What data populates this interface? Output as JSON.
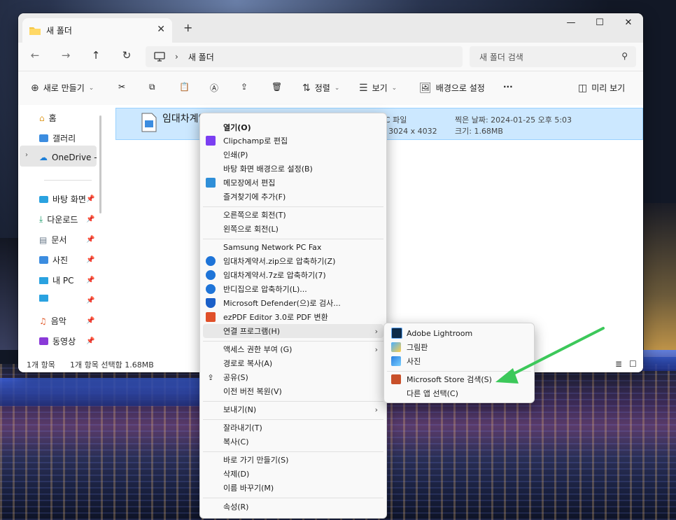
{
  "window": {
    "tab_title": "새 폴더",
    "tab_close": "✕",
    "new_tab": "+",
    "minimize": "—",
    "maximize": "☐",
    "close": "✕"
  },
  "nav": {
    "back": "←",
    "forward": "→",
    "up": "↑",
    "refresh": "↻",
    "breadcrumb_sep": "›",
    "breadcrumb_folder": "새 폴더",
    "search_placeholder": "새 폴더 검색"
  },
  "toolbar": {
    "new_label": "새로 만들기",
    "sort_label": "정렬",
    "view_label": "보기",
    "set_background_label": "배경으로 설정",
    "more_label": "···",
    "preview_label": "미리 보기"
  },
  "sidebar": {
    "items": [
      {
        "label": "홈",
        "icon": "home-icon"
      },
      {
        "label": "갤러리",
        "icon": "gallery-icon"
      },
      {
        "label": "OneDrive -",
        "icon": "cloud-icon"
      },
      {
        "label": "바탕 화면",
        "icon": "desktop-icon"
      },
      {
        "label": "다운로드",
        "icon": "download-icon"
      },
      {
        "label": "문서",
        "icon": "document-icon"
      },
      {
        "label": "사진",
        "icon": "pictures-icon"
      },
      {
        "label": "내 PC",
        "icon": "pc-icon"
      },
      {
        "label": "",
        "icon": "drive-icon"
      },
      {
        "label": "음악",
        "icon": "music-icon"
      },
      {
        "label": "동영상",
        "icon": "video-icon"
      }
    ]
  },
  "file": {
    "name": "임대차계약서",
    "type": "유형: HEIC 파일",
    "dimensions": "사진 크기: 3024 x 4032",
    "date_taken": "찍은 날짜: 2024-01-25 오후 5:03",
    "size": "크기: 1.68MB"
  },
  "status": {
    "count": "1개 항목",
    "selected": "1개 항목 선택함 1.68MB"
  },
  "context_menu": {
    "items": [
      {
        "label": "열기(O)",
        "bold": true
      },
      {
        "label": "Clipchamp로 편집",
        "icon": "clipchamp-icon"
      },
      {
        "label": "인쇄(P)"
      },
      {
        "label": "바탕 화면 배경으로 설정(B)"
      },
      {
        "label": "메모장에서 편집",
        "icon": "notepad-icon"
      },
      {
        "label": "즐겨찾기에 추가(F)"
      },
      {
        "label": "오른쪽으로 회전(T)"
      },
      {
        "label": "왼쪽으로 회전(L)"
      },
      {
        "label": "Samsung Network PC Fax"
      },
      {
        "label": "임대차계약서.zip으로 압축하기(Z)",
        "icon": "bandizip-icon"
      },
      {
        "label": "임대차계약서.7z로 압축하기(7)",
        "icon": "bandizip-icon"
      },
      {
        "label": "반디집으로 압축하기(L)...",
        "icon": "bandizip-icon"
      },
      {
        "label": "Microsoft Defender(으)로 검사...",
        "icon": "defender-icon"
      },
      {
        "label": "ezPDF Editor 3.0로 PDF 변환",
        "icon": "ezpdf-icon"
      },
      {
        "label": "연결 프로그램(H)",
        "arrow": "›"
      },
      {
        "label": "액세스 권한 부여 (G)",
        "arrow": "›"
      },
      {
        "label": "경로로 복사(A)"
      },
      {
        "label": "공유(S)",
        "icon": "share-icon"
      },
      {
        "label": "이전 버전 복원(V)"
      },
      {
        "label": "보내기(N)",
        "arrow": "›"
      },
      {
        "label": "잘라내기(T)"
      },
      {
        "label": "복사(C)"
      },
      {
        "label": "바로 가기 만들기(S)"
      },
      {
        "label": "삭제(D)"
      },
      {
        "label": "이름 바꾸기(M)"
      },
      {
        "label": "속성(R)"
      }
    ]
  },
  "submenu": {
    "items": [
      {
        "label": "Adobe Lightroom",
        "icon": "lightroom-icon"
      },
      {
        "label": "그림판",
        "icon": "paint-icon"
      },
      {
        "label": "사진",
        "icon": "photos-icon"
      },
      {
        "label": "Microsoft Store 검색(S)",
        "icon": "store-icon"
      },
      {
        "label": "다른 앱 선택(C)"
      }
    ]
  },
  "colors": {
    "selection": "#cce8ff",
    "arrow": "#3cc85a"
  }
}
